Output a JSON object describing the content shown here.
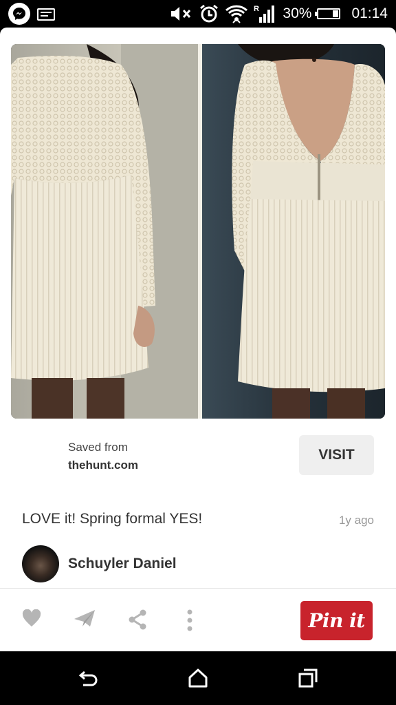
{
  "status_bar": {
    "battery_percent": "30%",
    "time": "01:14",
    "battery_level": 0.3,
    "icons": [
      "messenger-icon",
      "mail-icon",
      "mute-icon",
      "alarm-icon",
      "wifi-icon",
      "signal-icon",
      "battery-icon"
    ]
  },
  "pin": {
    "saved_from_label": "Saved from",
    "source_domain": "thehunt.com",
    "visit_label": "VISIT",
    "description": "LOVE it! Spring formal YES!",
    "time_ago": "1y ago",
    "pinner_name": "Schuyler Daniel"
  },
  "actions": {
    "icons": [
      "heart-icon",
      "send-icon",
      "share-icon",
      "more-icon"
    ],
    "pin_it_label": "Pin it"
  },
  "nav_bar": {
    "icons": [
      "back-icon",
      "home-icon",
      "recents-icon"
    ]
  },
  "colors": {
    "pin_red": "#c8232c",
    "visit_bg": "#efefef",
    "text_dark": "#333333",
    "text_muted": "#999999"
  }
}
